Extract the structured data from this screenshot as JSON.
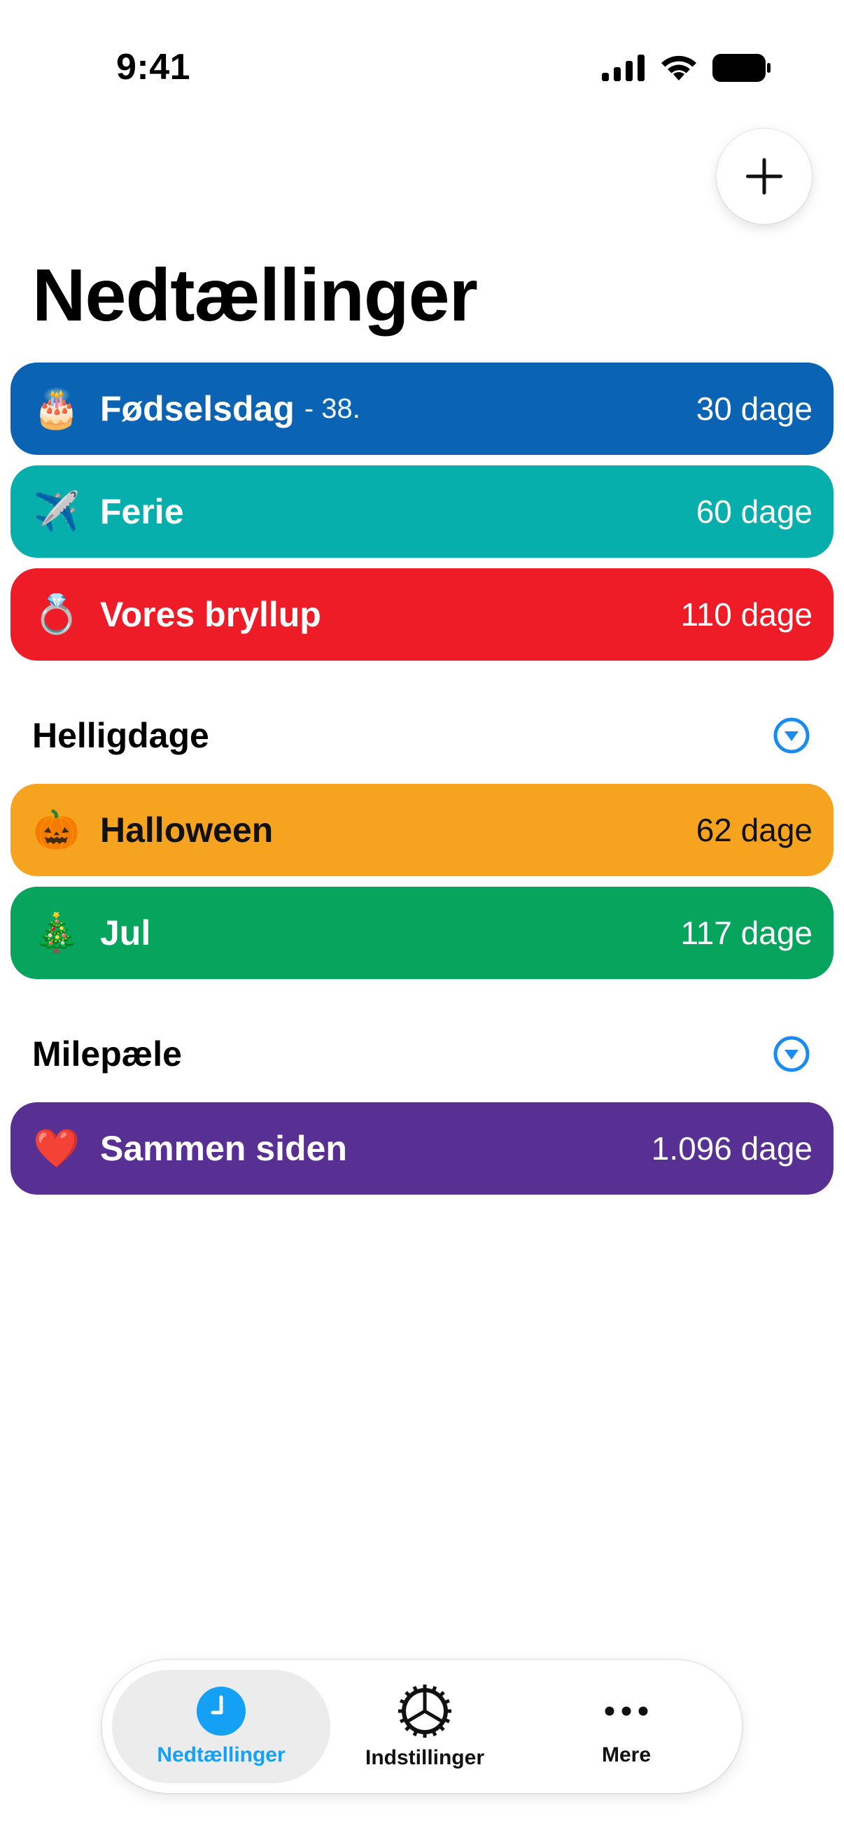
{
  "status_bar": {
    "time": "9:41"
  },
  "header": {
    "title": "Nedtællinger",
    "add_icon": "plus-icon"
  },
  "countdowns": [
    {
      "emoji": "🎂",
      "name": "Fødselsdag",
      "sub": "- 38.",
      "count": "30 dage",
      "color": "#0a64b3"
    },
    {
      "emoji": "✈️",
      "name": "Ferie",
      "sub": "",
      "count": "60 dage",
      "color": "#06aeac"
    },
    {
      "emoji": "💍",
      "name": "Vores bryllup",
      "sub": "",
      "count": "110 dage",
      "color": "#ee1c27"
    }
  ],
  "sections": [
    {
      "title": "Helligdage",
      "items": [
        {
          "emoji": "🎃",
          "name": "Halloween",
          "count": "62 dage",
          "color": "#f6a31f"
        },
        {
          "emoji": "🎄",
          "name": "Jul",
          "count": "117 dage",
          "color": "#06a45c"
        }
      ]
    },
    {
      "title": "Milepæle",
      "items": [
        {
          "emoji": "❤️",
          "name": "Sammen siden",
          "count": "1.096 dage",
          "color": "#582f92"
        }
      ]
    }
  ],
  "tab_bar": {
    "tabs": [
      {
        "label": "Nedtællinger",
        "icon": "clock-icon",
        "active": true
      },
      {
        "label": "Indstillinger",
        "icon": "gear-icon",
        "active": false
      },
      {
        "label": "Mere",
        "icon": "more-icon",
        "active": false
      }
    ]
  },
  "colors": {
    "accent": "#14a0f5",
    "toggle": "#1a8cf0"
  }
}
